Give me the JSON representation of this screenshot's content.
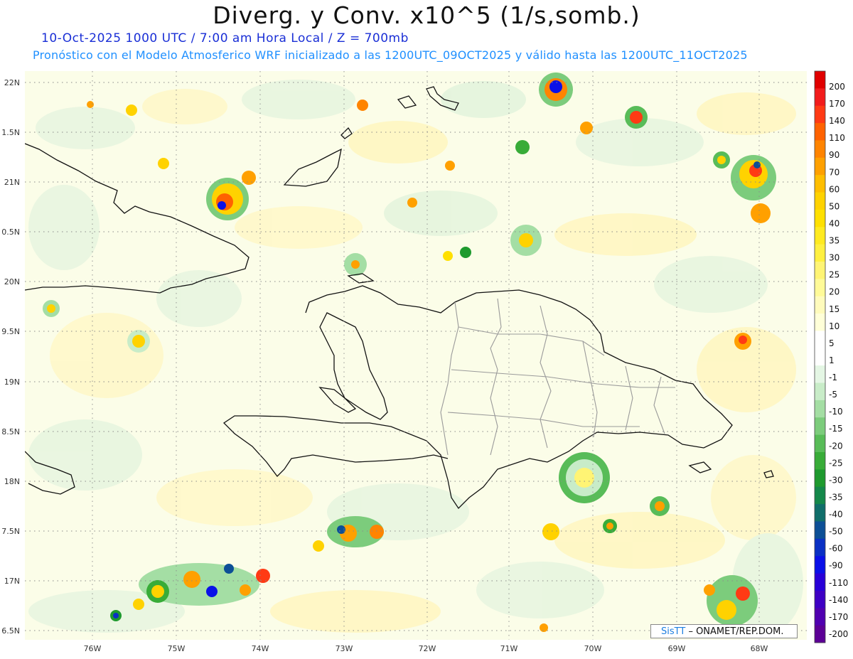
{
  "header": {
    "title": "Diverg. y Conv. x10^5 (1/s,somb.)",
    "subtitle": "10-Oct-2025  1000 UTC / 7:00 am Hora Local / Z = 700mb",
    "description": "Pronóstico con el Modelo Atmosferico WRF inicializado a las 1200UTC_09OCT2025 y válido hasta las  1200UTC_11OCT2025"
  },
  "map": {
    "lat_labels": [
      "22N",
      "1.5N",
      "21N",
      "0.5N",
      "20N",
      "9.5N",
      "19N",
      "8.5N",
      "18N",
      "7.5N",
      "17N",
      "6.5N"
    ],
    "lon_labels": [
      "76W",
      "75W",
      "74W",
      "73W",
      "72W",
      "71W",
      "70W",
      "69W",
      "68W"
    ]
  },
  "colorbar": {
    "labels": [
      "200",
      "170",
      "140",
      "110",
      "90",
      "70",
      "60",
      "50",
      "40",
      "35",
      "30",
      "25",
      "20",
      "15",
      "10",
      "5",
      "1",
      "-1",
      "-5",
      "-10",
      "-15",
      "-20",
      "-25",
      "-30",
      "-35",
      "-40",
      "-50",
      "-60",
      "-90",
      "-110",
      "-140",
      "-170",
      "-200"
    ],
    "colors": [
      "#e00000",
      "#f21c1c",
      "#ff3a14",
      "#ff6200",
      "#ff8400",
      "#ffa000",
      "#ffbe00",
      "#ffd200",
      "#ffe000",
      "#ffea20",
      "#fff040",
      "#fff474",
      "#fffa98",
      "#fffbbc",
      "#ffffd8",
      "#ffffff",
      "#ffffff",
      "#e4f6e4",
      "#c8ecc8",
      "#a4dea4",
      "#7ccc7c",
      "#58bc58",
      "#38ac38",
      "#1e9a2e",
      "#14884a",
      "#106e6a",
      "#0c4f96",
      "#0a30c4",
      "#0a10e8",
      "#2800d8",
      "#3e00c4",
      "#5000b0",
      "#5c0096"
    ]
  },
  "credit": {
    "brand": "SisTT",
    "text": "– ONAMET/REP.DOM."
  }
}
